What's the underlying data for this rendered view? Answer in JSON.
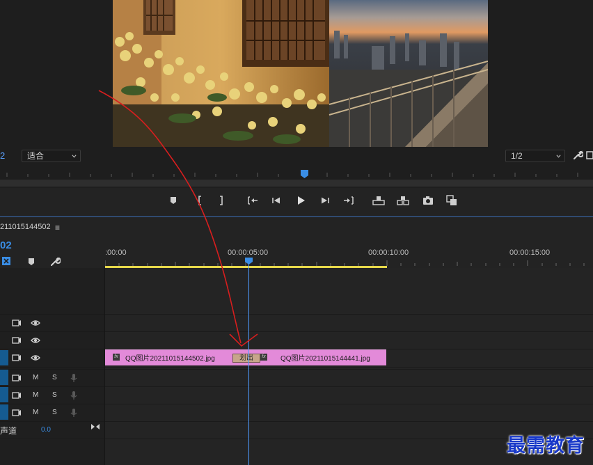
{
  "program_monitor": {
    "left_label": "2",
    "zoom_select": "适合",
    "resolution_select": "1/2"
  },
  "transport": {
    "icons": [
      "add-marker-icon",
      "mark-in-icon",
      "mark-out-icon",
      "go-to-in-icon",
      "step-back-icon",
      "play-icon",
      "step-forward-icon",
      "go-to-out-icon",
      "lift-icon",
      "extract-icon",
      "export-frame-icon",
      "comparison-view-icon"
    ]
  },
  "timeline": {
    "sequence_name": "211015144502",
    "menu_glyph": "≡",
    "timecode": "02",
    "ruler_labels": [
      ":00:00",
      "00:00:05:00",
      "00:00:10:00",
      "00:00:15:00"
    ],
    "clips": [
      {
        "name": "QQ图片20211015144502.jpg",
        "fx": "fx"
      },
      {
        "name": "QQ图片20211015144441.jpg",
        "fx": "fx"
      }
    ],
    "transition_label": "划出",
    "audio_tracks": [
      {
        "mute": "M",
        "solo": "S"
      },
      {
        "mute": "M",
        "solo": "S"
      },
      {
        "mute": "M",
        "solo": "S"
      }
    ],
    "master": {
      "label": "声道",
      "value": "0.0"
    }
  },
  "watermark": "最需教育",
  "colors": {
    "accent_blue": "#3a8ee6",
    "clip_pink": "#e38ad9",
    "work_area_yellow": "#e6d84a",
    "annotation_red": "#d81e1e"
  }
}
